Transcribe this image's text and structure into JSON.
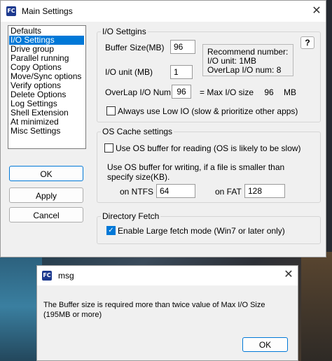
{
  "main_window": {
    "icon_text": "FC",
    "title": "Main Settings",
    "close_glyph": "✕",
    "categories": [
      {
        "label": "Defaults",
        "selected": false
      },
      {
        "label": "I/O Settings",
        "selected": true
      },
      {
        "label": "Drive group",
        "selected": false
      },
      {
        "label": "Parallel running",
        "selected": false
      },
      {
        "label": "Copy Options",
        "selected": false
      },
      {
        "label": "Move/Sync options",
        "selected": false
      },
      {
        "label": "Verify options",
        "selected": false
      },
      {
        "label": "Delete Options",
        "selected": false
      },
      {
        "label": "Log Settings",
        "selected": false
      },
      {
        "label": "Shell Extension",
        "selected": false
      },
      {
        "label": "At minimized",
        "selected": false
      },
      {
        "label": "Misc Settings",
        "selected": false
      }
    ],
    "buttons": {
      "ok": "OK",
      "apply": "Apply",
      "cancel": "Cancel"
    },
    "io_settings": {
      "group_label": "I/O Settgins",
      "buffer_size_label": "Buffer Size(MB)",
      "buffer_size_value": "96",
      "io_unit_label": "I/O unit (MB)",
      "io_unit_value": "1",
      "overlap_label": "OverLap I/O Num",
      "overlap_value": "96",
      "max_io_label": "= Max I/O size",
      "max_io_value": "96",
      "max_io_unit": "MB",
      "recommend": {
        "line1": "Recommend number:",
        "line2": "I/O unit: 1MB",
        "line3": "OverLap I/O num: 8"
      },
      "help_label": "?",
      "always_low_io_label": "Always use Low IO (slow & prioritize other apps)",
      "always_low_io_checked": false
    },
    "os_cache": {
      "group_label": "OS Cache settings",
      "use_os_buffer_reading_label": "Use OS buffer for reading (OS is likely to be slow)",
      "use_os_buffer_reading_checked": false,
      "writing_desc_line1": "Use OS buffer for writing, if a file is smaller than",
      "writing_desc_line2": "specify size(KB).",
      "ntfs_label": "on NTFS",
      "ntfs_value": "64",
      "fat_label": "on FAT",
      "fat_value": "128"
    },
    "directory_fetch": {
      "group_label": "Directory Fetch",
      "large_fetch_label": "Enable Large fetch mode (Win7 or later only)",
      "large_fetch_checked": true,
      "check_glyph": "✓"
    }
  },
  "msg_dialog": {
    "icon_text": "FC",
    "title": "msg",
    "close_glyph": "✕",
    "message": "The Buffer size is required more than twice value of Max I/O Size (195MB or more)",
    "ok_label": "OK"
  }
}
